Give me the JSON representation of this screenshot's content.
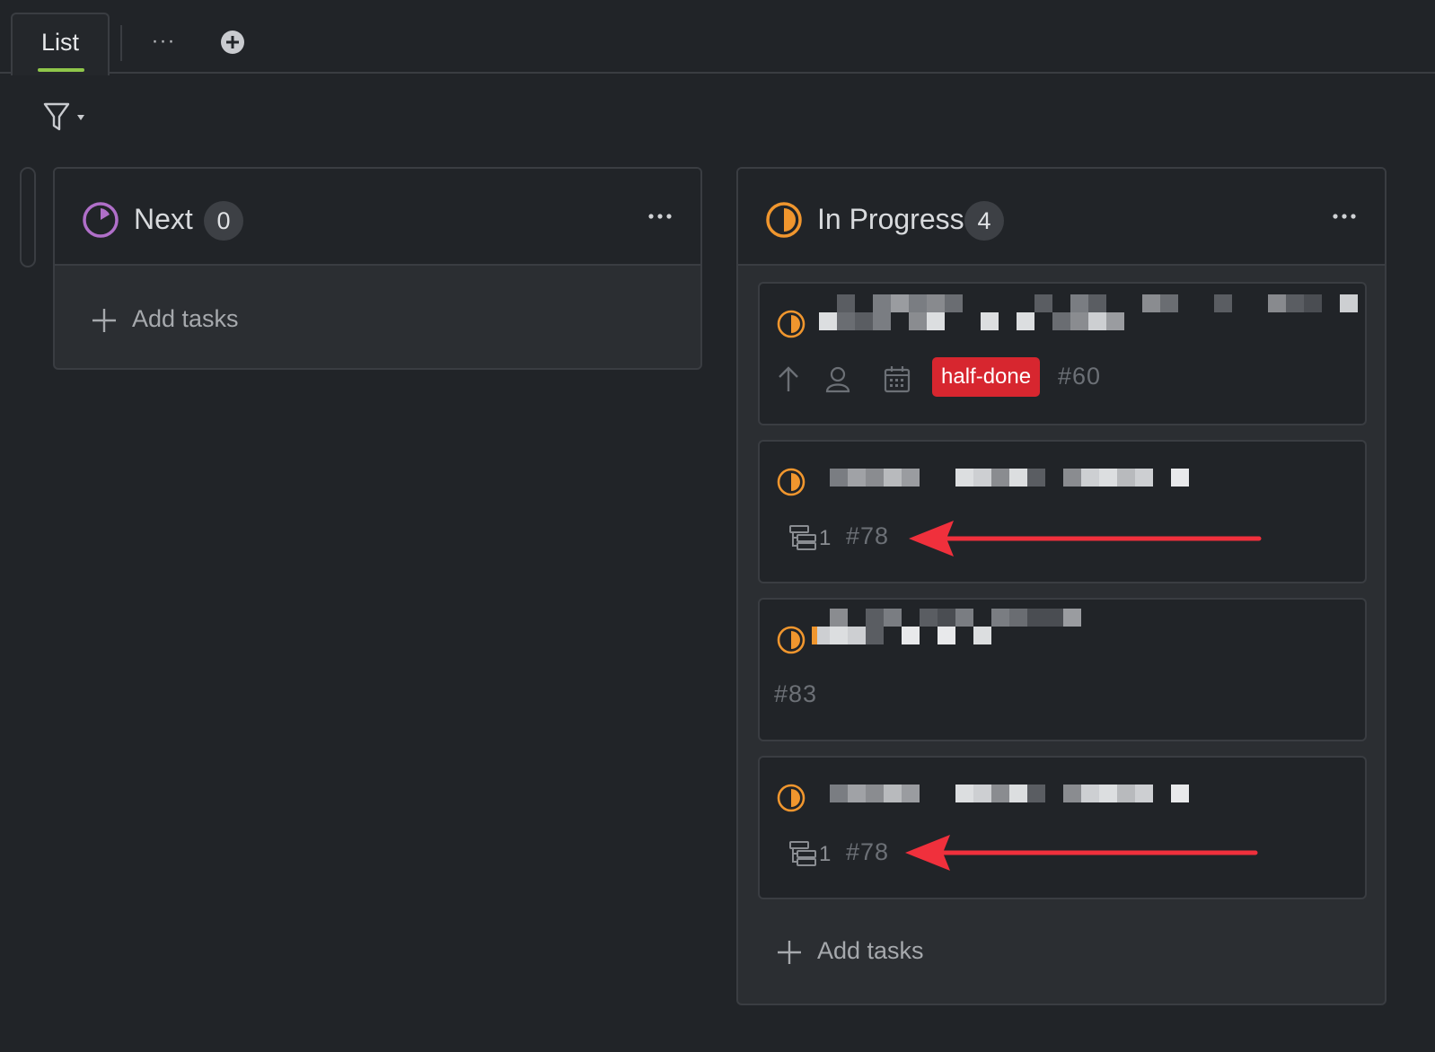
{
  "tabs": {
    "active_label": "List",
    "more_label": "···"
  },
  "colors": {
    "background": "#212428",
    "accent_tab": "#8fc64a",
    "status_next": "#b06fc9",
    "status_in_progress": "#f0962e",
    "tag_red": "#d7262f",
    "annotation_arrow": "#f0303c"
  },
  "columns": [
    {
      "title": "Next",
      "count": "0",
      "status_icon": "purple-progress-ring-icon",
      "add_label": "Add tasks",
      "cards": []
    },
    {
      "title": "In Progress",
      "count": "4",
      "status_icon": "orange-half-circle-icon",
      "add_label": "Add tasks",
      "cards": [
        {
          "title": "[redacted]",
          "tag": "half-done",
          "id": "#60",
          "icons": [
            "arrow-up-icon",
            "user-icon",
            "calendar-icon"
          ]
        },
        {
          "title": "[redacted]",
          "subtask_count": "1",
          "id": "#78"
        },
        {
          "title": "[redacted]",
          "id": "#83"
        },
        {
          "title": "[redacted]",
          "subtask_count": "1",
          "id": "#78"
        }
      ]
    }
  ]
}
